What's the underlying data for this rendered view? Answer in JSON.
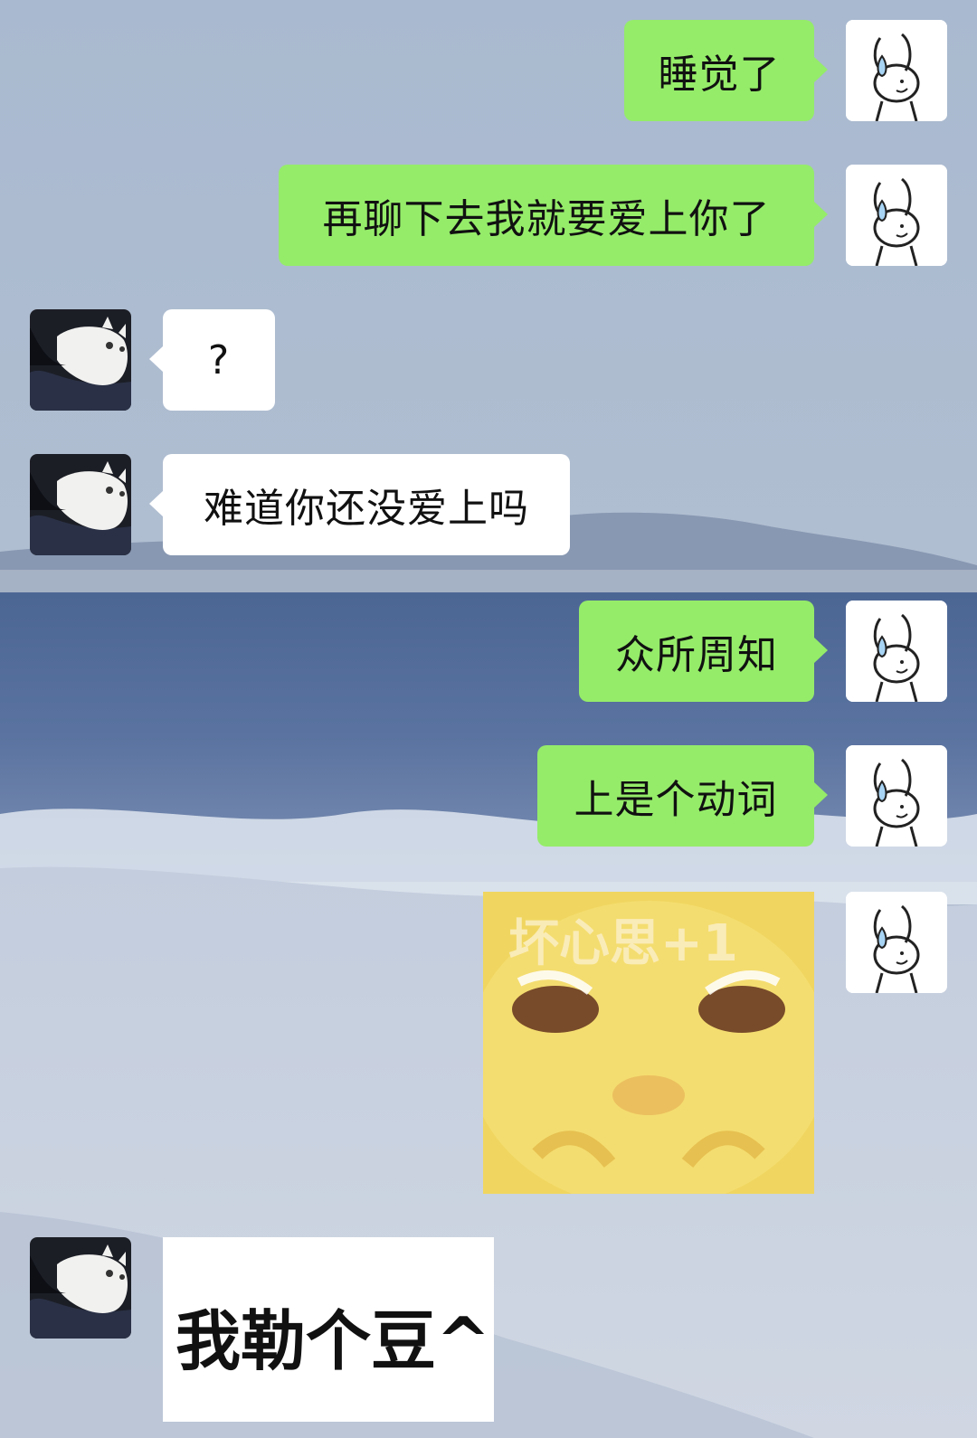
{
  "messages": [
    {
      "sender": "me",
      "text": "睡觉了"
    },
    {
      "sender": "me",
      "text": "再聊下去我就要爱上你了"
    },
    {
      "sender": "them",
      "text": "?"
    },
    {
      "sender": "them",
      "text": "难道你还没爱上吗"
    },
    {
      "sender": "me",
      "text": "众所周知"
    },
    {
      "sender": "me",
      "text": "上是个动词"
    },
    {
      "sender": "me",
      "type": "sticker",
      "text": "坏心思+1"
    },
    {
      "sender": "them",
      "type": "sticker",
      "text": "我勒个豆^"
    }
  ],
  "avatars": {
    "me": "rabbit-with-sweat-drop-icon",
    "them": "white-cat-photo"
  },
  "colors": {
    "my_bubble": "#95ec69",
    "their_bubble": "#ffffff"
  }
}
